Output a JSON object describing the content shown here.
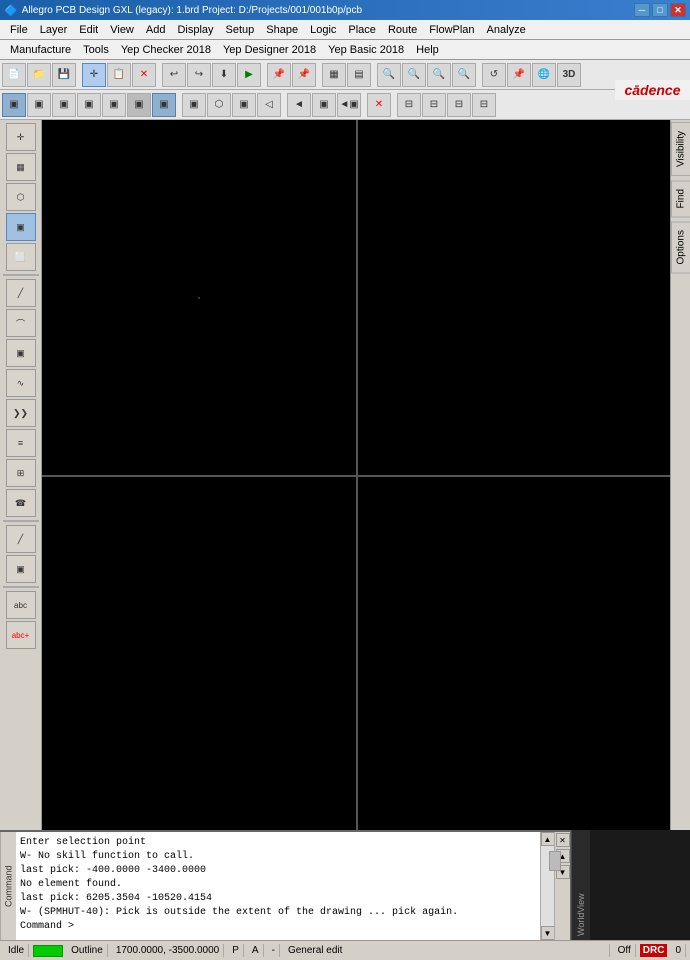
{
  "titlebar": {
    "icon": "🔷",
    "title": "Allegro PCB Design GXL (legacy): 1.brd  Project: D:/Projects/001/001b0p/pcb",
    "minimize": "─",
    "maximize": "□",
    "close": "✕"
  },
  "menubar1": {
    "items": [
      "File",
      "Layer",
      "Edit",
      "View",
      "Add",
      "Display",
      "Setup",
      "Shape",
      "Logic",
      "Place",
      "Route",
      "FlowPlan",
      "Analyze"
    ]
  },
  "menubar2": {
    "items": [
      "Manufacture",
      "Tools",
      "Yep Checker 2018",
      "Yep Designer 2018",
      "Yep Basic 2018",
      "Help"
    ],
    "cadence": "cādence"
  },
  "right_tabs": [
    "Visibility",
    "Find",
    "Options"
  ],
  "console": {
    "label": "Command",
    "lines": [
      "Enter selection point",
      "W- No skill function to call.",
      "last pick:  -400.0000 -3400.0000",
      "No element found.",
      "last pick:  6205.3504 -10520.4154",
      "W- (SPMHUT-40): Pick is outside the extent of the drawing ... pick again.",
      "Command >"
    ]
  },
  "status_bar": {
    "idle": "Idle",
    "outline": "Outline",
    "coords": "1700.0000, -3500.0000",
    "p": "P",
    "a": "A",
    "dash": "-",
    "general_edit": "General edit",
    "off": "Off",
    "drc": "DRC",
    "num": "0"
  },
  "toolbar1": {
    "buttons": [
      "📄",
      "📁",
      "💾",
      "✛",
      "📋",
      "✕",
      "↩",
      "↪",
      "⬇",
      "▶",
      "📌",
      "📌",
      "▦",
      "▤",
      "🔍",
      "🔍",
      "🔍",
      "🔍",
      "↺",
      "📌",
      "🌐"
    ]
  },
  "toolbar2": {
    "buttons": [
      "▣",
      "▣",
      "▣",
      "▣",
      "▣",
      "▣",
      "▣",
      "▣",
      "▣",
      "▣",
      "▣",
      "▣",
      "▣",
      "▣",
      "▣",
      "▣",
      "▣",
      "▣"
    ]
  },
  "sidebar_groups": {
    "group1": [
      "✛",
      "▦",
      "⬡",
      "▣",
      "⬜"
    ],
    "group2": [
      "╱",
      "⌒",
      "▣",
      "∿",
      "❯❯",
      "≡",
      "⊞",
      "☎"
    ],
    "group3": [
      "╱",
      "▣",
      "abc",
      "abc"
    ]
  }
}
